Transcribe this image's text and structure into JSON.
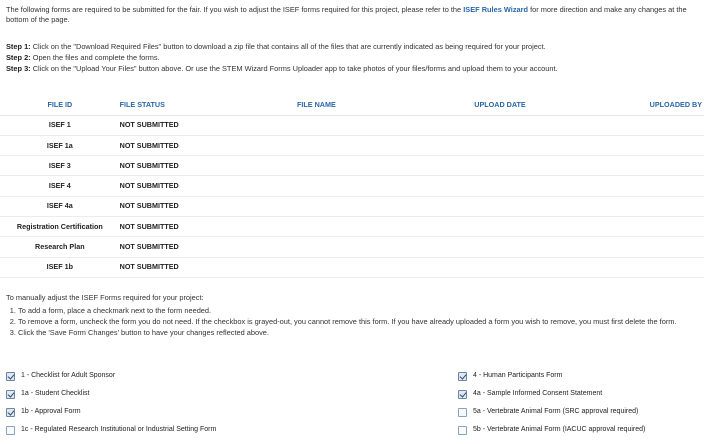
{
  "intro": {
    "text_before": "The following forms are required to be submitted for the fair. If you wish to adjust the ISEF forms required for this project, please refer to the ",
    "link": "ISEF Rules Wizard",
    "text_after": " for more direction and make any changes at the bottom of the page."
  },
  "steps": [
    {
      "label": "Step 1:",
      "text": " Click on the \"Download Required Files\" button to download a zip file that contains all of the files that are currently indicated as being required for your project."
    },
    {
      "label": "Step 2:",
      "text": " Open the files and complete the forms."
    },
    {
      "label": "Step 3:",
      "text": " Click on the \"Upload Your Files\" button above. Or use the STEM Wizard Forms Uploader app to take photos of your files/forms and upload them to your account."
    }
  ],
  "table": {
    "headers": [
      "FILE ID",
      "FILE STATUS",
      "FILE NAME",
      "UPLOAD DATE",
      "UPLOADED BY"
    ],
    "rows": [
      {
        "id": "ISEF 1",
        "status": "NOT SUBMITTED"
      },
      {
        "id": "ISEF 1a",
        "status": "NOT SUBMITTED"
      },
      {
        "id": "ISEF 3",
        "status": "NOT SUBMITTED"
      },
      {
        "id": "ISEF 4",
        "status": "NOT SUBMITTED"
      },
      {
        "id": "ISEF 4a",
        "status": "NOT SUBMITTED"
      },
      {
        "id": "Registration Certification",
        "status": "NOT SUBMITTED"
      },
      {
        "id": "Research Plan",
        "status": "NOT SUBMITTED"
      },
      {
        "id": "ISEF 1b",
        "status": "NOT SUBMITTED"
      }
    ]
  },
  "manual": {
    "heading": "To manually adjust the ISEF Forms required for your project:",
    "instructions": [
      "To add a form, place a checkmark next to the form needed.",
      "To remove a form, uncheck the form you do not need. If the checkbox is grayed-out, you cannot remove this form. If you have already uploaded a form you wish to remove, you must first delete the form.",
      "Click the 'Save Form Changes' button to have your changes reflected above."
    ]
  },
  "forms_left": [
    {
      "label": "1 - Checklist for Adult Sponsor",
      "checked": true
    },
    {
      "label": "1a - Student Checklist",
      "checked": true
    },
    {
      "label": "1b - Approval Form",
      "checked": true
    },
    {
      "label": "1c - Regulated Research Institutional or Industrial Setting Form",
      "checked": false
    }
  ],
  "forms_right": [
    {
      "label": "4 - Human Participants Form",
      "checked": true
    },
    {
      "label": "4a - Sample Informed Consent Statement",
      "checked": true
    },
    {
      "label": "5a - Vertebrate Animal Form (SRC approval required)",
      "checked": false
    },
    {
      "label": "5b - Vertebrate Animal Form (IACUC approval required)",
      "checked": false
    }
  ]
}
